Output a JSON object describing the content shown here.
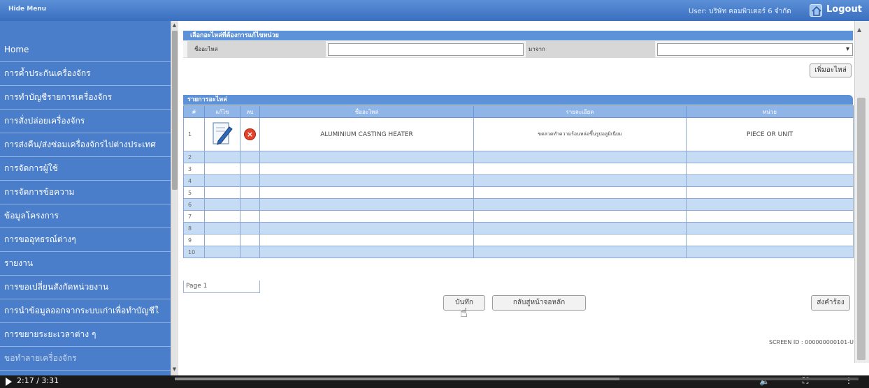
{
  "topbar": {
    "hide_menu_label": "Hide Menu",
    "user_text": "User: บริษัท คอมพิวเตอร์ 6 จำกัด",
    "logout_label": "Logout"
  },
  "sidebar": {
    "items": [
      {
        "label": "Home"
      },
      {
        "label": "การค้ำประกันเครื่องจักร"
      },
      {
        "label": "การทำบัญชีรายการเครื่องจักร"
      },
      {
        "label": "การสั่งปล่อยเครื่องจักร"
      },
      {
        "label": "การส่งคืน/ส่งซ่อมเครื่องจักรไปต่างประเทศ"
      },
      {
        "label": "การจัดการผู้ใช้"
      },
      {
        "label": "การจัดการข้อความ"
      },
      {
        "label": "ข้อมูลโครงการ"
      },
      {
        "label": "การขออุทธรณ์ต่างๆ"
      },
      {
        "label": "รายงาน"
      },
      {
        "label": "การขอเปลี่ยนสังกัดหน่วยงาน"
      },
      {
        "label": "การนำข้อมูลออกจากระบบเก่าเพื่อทำบัญชีใ"
      },
      {
        "label": "การขยายระยะเวลาต่าง ๆ"
      },
      {
        "label": "ขอทำลายเครื่องจักร"
      }
    ]
  },
  "add_section": {
    "header": "เลือกอะไหล่ที่ต้องการแก้ไขหน่วย",
    "name_label": "ชื่ออะไหล่",
    "name_value": "",
    "source_label": "มาจาก",
    "source_value": "",
    "add_button": "เพิ่มอะไหล่"
  },
  "list_section": {
    "header": "รายการอะไหล่",
    "columns": [
      "#",
      "แก้ไข",
      "ลบ",
      "ชื่ออะไหล่",
      "รายละเอียด",
      "หน่วย"
    ],
    "rows": [
      {
        "num": "1",
        "name": "ALUMINIUM CASTING HEATER",
        "desc": "ขดลวดทำความร้อนหล่อขึ้นรูปอลูมิเนียม",
        "unit": "PIECE OR UNIT"
      },
      {
        "num": "2",
        "name": "",
        "desc": "",
        "unit": ""
      },
      {
        "num": "3",
        "name": "",
        "desc": "",
        "unit": ""
      },
      {
        "num": "4",
        "name": "",
        "desc": "",
        "unit": ""
      },
      {
        "num": "5",
        "name": "",
        "desc": "",
        "unit": ""
      },
      {
        "num": "6",
        "name": "",
        "desc": "",
        "unit": ""
      },
      {
        "num": "7",
        "name": "",
        "desc": "",
        "unit": ""
      },
      {
        "num": "8",
        "name": "",
        "desc": "",
        "unit": ""
      },
      {
        "num": "9",
        "name": "",
        "desc": "",
        "unit": ""
      },
      {
        "num": "10",
        "name": "",
        "desc": "",
        "unit": ""
      }
    ],
    "pager": "Page 1"
  },
  "actions": {
    "save": "บันทึก",
    "back": "กลับสู่หน้าจอหลัก",
    "submit": "ส่งคำร้อง"
  },
  "screen_id": "SCREEN ID : 000000000101-U",
  "video": {
    "time": "2:17 / 3:31",
    "progress_fraction": 0.65
  },
  "colors": {
    "sidebar": "#4a7ecb",
    "header_blue": "#5e92d8",
    "row_blue": "#c6dcf5",
    "delete_red": "#e0432b"
  }
}
